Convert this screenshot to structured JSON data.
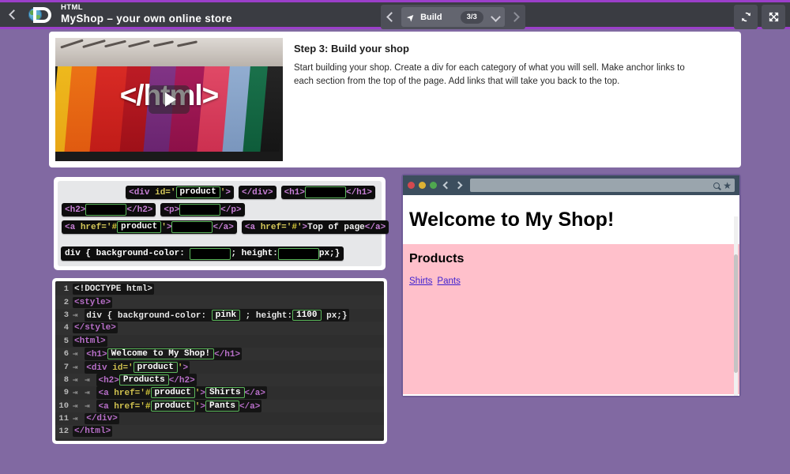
{
  "topbar": {
    "back_icon": "chevron-left-icon",
    "logo_icon": "globe-d-logo-icon",
    "course_label": "HTML",
    "project_title": "MyShop – your own online store",
    "nav_prev_icon": "chevron-left-icon",
    "nav_next_icon": "chevron-right-icon",
    "lesson_icon": "rocket-icon",
    "lesson_label": "Build",
    "lesson_count": "3/3",
    "lesson_dropdown_icon": "chevron-down-icon",
    "refresh_icon": "refresh-icon",
    "fullscreen_icon": "fullscreen-icon"
  },
  "lesson": {
    "video_code_text": "</html>",
    "play_icon": "play-icon",
    "step_title": "Step 3: Build your shop",
    "step_body": "Start building your shop. Create a div for each category of what you will sell. Make anchor links to each section from the top of the page. Add links that will take you back to the top."
  },
  "palette": {
    "row1": [
      {
        "name": "block-div-open",
        "parts": [
          {
            "t": "tag",
            "v": "<div "
          },
          {
            "t": "attr",
            "v": "id="
          },
          {
            "t": "attr",
            "v": "'"
          },
          {
            "t": "slot",
            "v": "product"
          },
          {
            "t": "attr",
            "v": "'"
          },
          {
            "t": "tag",
            "v": ">"
          }
        ]
      },
      {
        "name": "block-div-close",
        "parts": [
          {
            "t": "tag",
            "v": "</div>"
          }
        ]
      },
      {
        "name": "block-h1",
        "parts": [
          {
            "t": "tag",
            "v": "<h1>"
          },
          {
            "t": "slot",
            "v": ""
          },
          {
            "t": "tag",
            "v": "</h1>"
          }
        ]
      }
    ],
    "row2": [
      {
        "name": "block-h2",
        "parts": [
          {
            "t": "tag",
            "v": "<h2>"
          },
          {
            "t": "slot",
            "v": ""
          },
          {
            "t": "tag",
            "v": "</h2>"
          }
        ]
      },
      {
        "name": "block-p",
        "parts": [
          {
            "t": "tag",
            "v": "<p>"
          },
          {
            "t": "slot",
            "v": ""
          },
          {
            "t": "tag",
            "v": "</p>"
          }
        ]
      }
    ],
    "row3": [
      {
        "name": "block-anchor-product",
        "parts": [
          {
            "t": "tag",
            "v": "<a "
          },
          {
            "t": "attr",
            "v": "href="
          },
          {
            "t": "attr",
            "v": "'"
          },
          {
            "t": "hash",
            "v": "#"
          },
          {
            "t": "slot",
            "v": "product"
          },
          {
            "t": "attr",
            "v": "'"
          },
          {
            "t": "tag",
            "v": ">"
          },
          {
            "t": "slot",
            "v": ""
          },
          {
            "t": "tag",
            "v": "</a>"
          }
        ]
      },
      {
        "name": "block-anchor-top",
        "parts": [
          {
            "t": "tag",
            "v": "<a "
          },
          {
            "t": "attr",
            "v": "href="
          },
          {
            "t": "attr",
            "v": "'"
          },
          {
            "t": "hash",
            "v": "#"
          },
          {
            "t": "attr",
            "v": "'"
          },
          {
            "t": "tag",
            "v": ">"
          },
          {
            "t": "plain",
            "v": "Top of page"
          },
          {
            "t": "tag",
            "v": "</a>"
          }
        ]
      }
    ],
    "css_block": {
      "name": "block-css-div-style",
      "prefix": "div { background-color:",
      "slot1": "",
      "middle": "; height:",
      "slot2": "",
      "suffix": "px;}"
    }
  },
  "editor": {
    "lines": [
      {
        "n": "1",
        "indent": 0,
        "parts": [
          {
            "t": "plain",
            "v": "<!DOCTYPE html>"
          }
        ]
      },
      {
        "n": "2",
        "indent": 0,
        "parts": [
          {
            "t": "tag",
            "v": "<style>"
          }
        ]
      },
      {
        "n": "3",
        "indent": 1,
        "parts": [
          {
            "t": "plain",
            "v": "div { background-color: "
          },
          {
            "t": "slot",
            "v": "pink"
          },
          {
            "t": "plain",
            "v": " ; height:"
          },
          {
            "t": "slot",
            "v": "1100"
          },
          {
            "t": "plain",
            "v": " px;}"
          }
        ]
      },
      {
        "n": "4",
        "indent": 0,
        "parts": [
          {
            "t": "tag",
            "v": "</style>"
          }
        ]
      },
      {
        "n": "5",
        "indent": 0,
        "parts": [
          {
            "t": "tag",
            "v": "<html>"
          }
        ]
      },
      {
        "n": "6",
        "indent": 1,
        "parts": [
          {
            "t": "tag",
            "v": "<h1>"
          },
          {
            "t": "slot",
            "v": "Welcome to My Shop!"
          },
          {
            "t": "tag",
            "v": "</h1>"
          }
        ]
      },
      {
        "n": "7",
        "indent": 1,
        "parts": [
          {
            "t": "tag",
            "v": "<div "
          },
          {
            "t": "attr",
            "v": "id='"
          },
          {
            "t": "slot",
            "v": "product"
          },
          {
            "t": "attr",
            "v": "'"
          },
          {
            "t": "tag",
            "v": ">"
          }
        ]
      },
      {
        "n": "8",
        "indent": 2,
        "parts": [
          {
            "t": "tag",
            "v": "<h2>"
          },
          {
            "t": "slot",
            "v": "Products"
          },
          {
            "t": "tag",
            "v": "</h2>"
          }
        ]
      },
      {
        "n": "9",
        "indent": 2,
        "parts": [
          {
            "t": "tag",
            "v": "<a "
          },
          {
            "t": "attr",
            "v": "href='"
          },
          {
            "t": "hash",
            "v": "#"
          },
          {
            "t": "slot",
            "v": "product"
          },
          {
            "t": "attr",
            "v": "'"
          },
          {
            "t": "tag",
            "v": ">"
          },
          {
            "t": "slot",
            "v": "Shirts"
          },
          {
            "t": "tag",
            "v": "</a>"
          }
        ]
      },
      {
        "n": "10",
        "indent": 2,
        "parts": [
          {
            "t": "tag",
            "v": "<a "
          },
          {
            "t": "attr",
            "v": "href='"
          },
          {
            "t": "hash",
            "v": "#"
          },
          {
            "t": "slot",
            "v": "product"
          },
          {
            "t": "attr",
            "v": "'"
          },
          {
            "t": "tag",
            "v": ">"
          },
          {
            "t": "slot",
            "v": "Pants"
          },
          {
            "t": "tag",
            "v": "</a>"
          }
        ]
      },
      {
        "n": "11",
        "indent": 1,
        "parts": [
          {
            "t": "tag",
            "v": "</div>"
          }
        ]
      },
      {
        "n": "12",
        "indent": 0,
        "parts": [
          {
            "t": "tag",
            "v": "</html>"
          }
        ]
      }
    ]
  },
  "preview": {
    "traffic_lights": [
      "close-dot-red",
      "minimize-dot-yellow",
      "maximize-dot-green"
    ],
    "back_icon": "chevron-left-icon",
    "forward_icon": "chevron-right-icon",
    "address_value": "",
    "address_placeholder": "",
    "search_icon": "search-icon",
    "bookmark_icon": "star-icon",
    "page": {
      "h1": "Welcome to My Shop!",
      "h2": "Products",
      "links": [
        "Shirts",
        "Pants"
      ],
      "div_background_color": "#ffc0cb"
    }
  },
  "colors": {
    "app_background": "#8169a2",
    "topbar": "#3a3c42",
    "topbar_accent": "#9b3fc9",
    "editor_background": "#2b2b2b",
    "slot_border": "#5cb85c",
    "tag_color": "#b86fc9",
    "attr_color": "#cfc04e",
    "link_color": "#3c1fd0"
  }
}
